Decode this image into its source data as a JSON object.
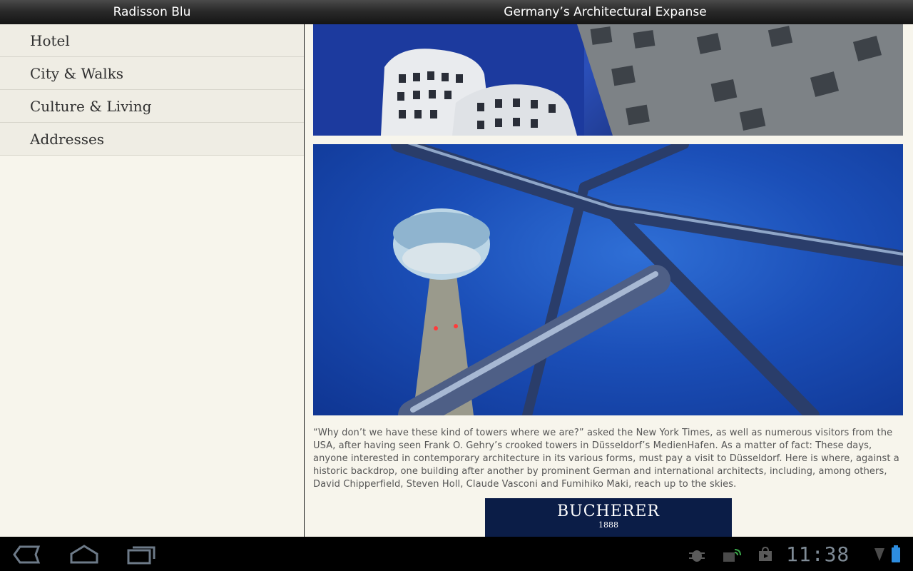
{
  "titlebar": {
    "app_title": "Radisson Blu",
    "page_title": "Germany’s Architectural Expanse"
  },
  "sidebar": {
    "items": [
      {
        "label": "Hotel"
      },
      {
        "label": "City & Walks"
      },
      {
        "label": "Culture & Living"
      },
      {
        "label": "Addresses"
      }
    ]
  },
  "content": {
    "article_text": "“Why don’t we have these kind of towers where we are?” asked the New York Times, as well as numerous visitors from the USA, after having seen Frank O. Gehry’s crooked towers in Düsseldorf’s MedienHafen. As a matter of fact: These days, anyone interested in contemporary architecture in its various forms, must pay a visit to Düsseldorf. Here is where, against a historic backdrop, one building after another by prominent German and international architects, including, among others, David Chipperfield, Steven Holl, Claude Vasconi and Fumihiko Maki, reach up to the skies.",
    "ad": {
      "brand": "BUCHERER",
      "year": "1888"
    }
  },
  "systembar": {
    "time": "11:38",
    "icons": [
      "back-icon",
      "home-icon",
      "recent-apps-icon",
      "debug-icon",
      "sync-icon",
      "store-icon",
      "signal-icon",
      "battery-icon"
    ]
  },
  "colors": {
    "background": "#f7f5ec",
    "menu_item_bg": "#efede4",
    "ad_bg": "#0b1d47",
    "sky_blue": "#1b4fb8",
    "clock": "#7f8b96"
  }
}
